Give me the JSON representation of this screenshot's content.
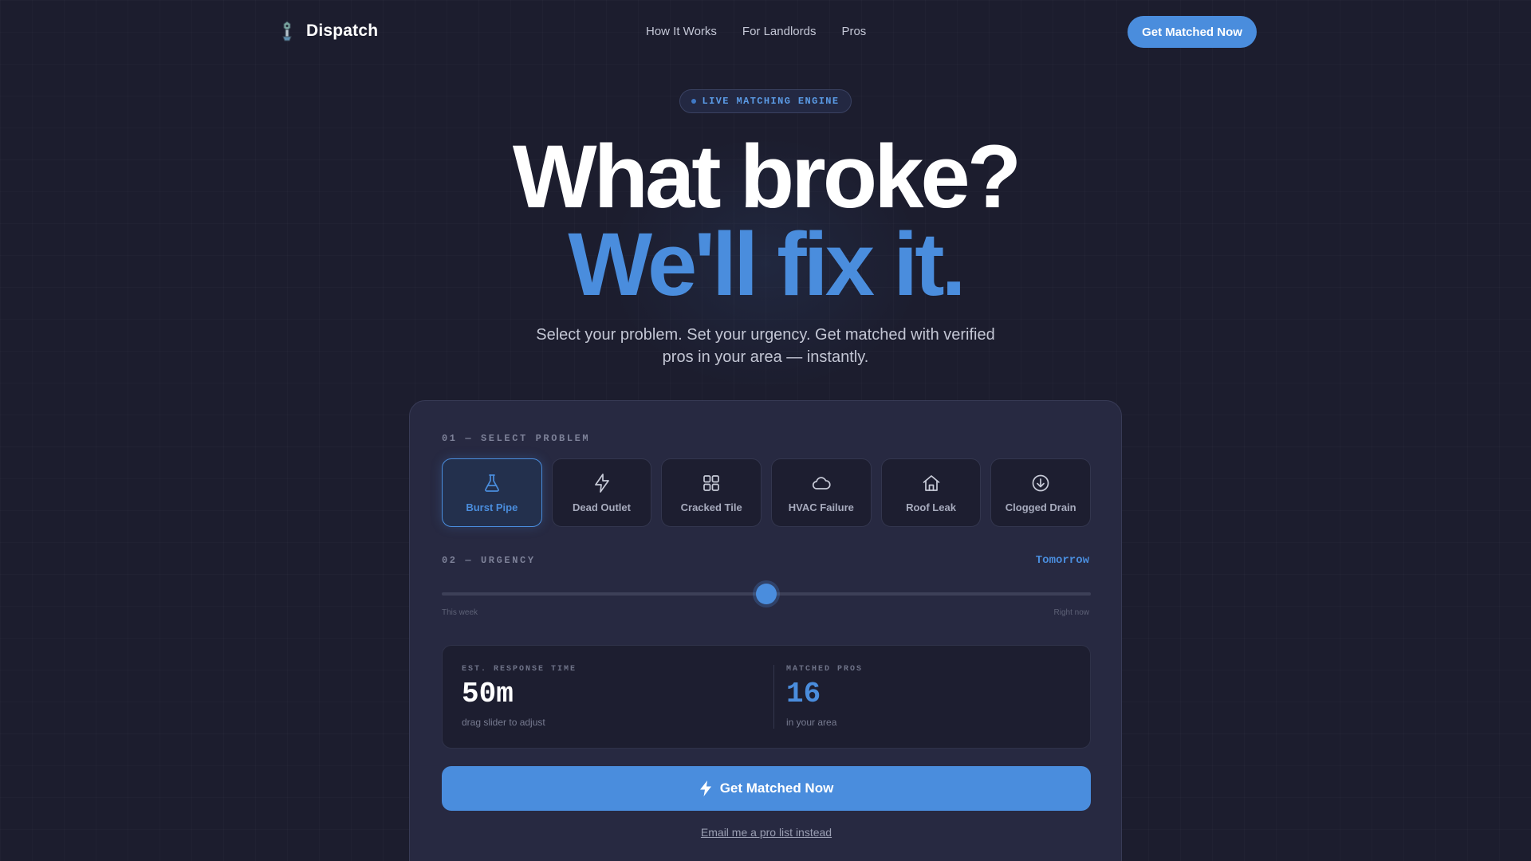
{
  "nav": {
    "brand": "Dispatch",
    "links": [
      "How It Works",
      "For Landlords",
      "Pros"
    ],
    "cta_label": "Get Matched Now"
  },
  "hero": {
    "badge": "LIVE MATCHING ENGINE",
    "line1": "What broke?",
    "line2": "We'll fix it.",
    "subtitle": "Select your problem. Set your urgency. Get matched with verified pros in your area — instantly."
  },
  "card": {
    "step1_label": "01 — SELECT PROBLEM",
    "problems": [
      {
        "label": "Burst Pipe",
        "icon": "flask-icon",
        "selected": true
      },
      {
        "label": "Dead Outlet",
        "icon": "lightning-icon",
        "selected": false
      },
      {
        "label": "Cracked Tile",
        "icon": "grid-icon",
        "selected": false
      },
      {
        "label": "HVAC Failure",
        "icon": "cloud-icon",
        "selected": false
      },
      {
        "label": "Roof Leak",
        "icon": "house-icon",
        "selected": false
      },
      {
        "label": "Clogged Drain",
        "icon": "download-circle-icon",
        "selected": false
      }
    ],
    "step2_label": "02 — URGENCY",
    "urgency_value": "Tomorrow",
    "urgency_level": 0.5,
    "slider_min_label": "This week",
    "slider_max_label": "Right now",
    "stats": {
      "response_label": "EST. RESPONSE TIME",
      "response_value": "50m",
      "response_sub": "drag slider to adjust",
      "pros_label": "MATCHED PROS",
      "pros_value": "16",
      "pros_sub": "in your area"
    },
    "cta_label": "Get Matched Now",
    "email_link": "Email me a pro list instead"
  },
  "colors": {
    "background": "#1c1d2e",
    "accent": "#4a8ddd",
    "card": "#272941"
  }
}
